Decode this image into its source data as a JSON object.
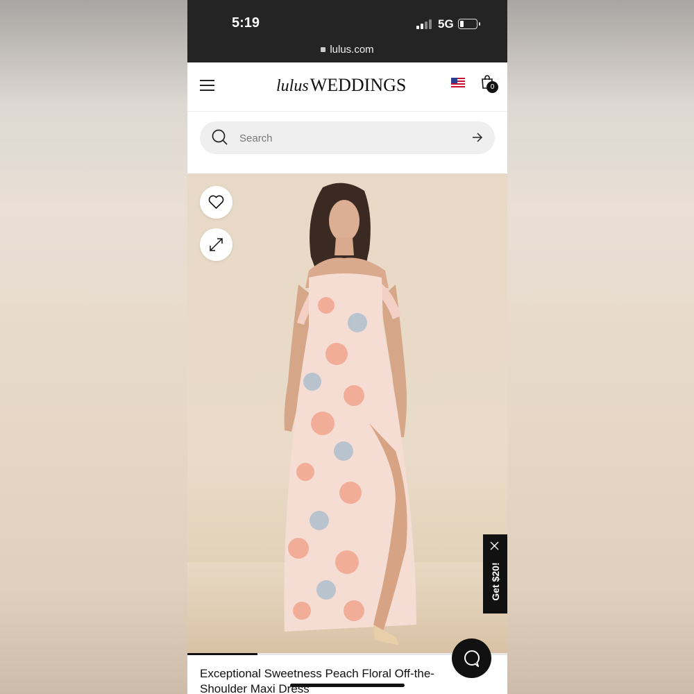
{
  "status": {
    "time": "5:19",
    "network": "5G",
    "url": "lulus.com"
  },
  "header": {
    "logo_script": "lulus",
    "logo_brand": "WEDDINGS",
    "cart_count": "0",
    "icons": [
      "hamburger-menu-icon",
      "us-flag-icon",
      "shopping-bag-icon"
    ]
  },
  "search": {
    "placeholder": "Search",
    "icons": [
      "search-icon",
      "arrow-right-icon"
    ]
  },
  "product": {
    "gallery_icons": [
      "heart-icon",
      "expand-icon"
    ],
    "gallery_progress": 0.22,
    "title": "Exceptional Sweetness Peach Floral Off-the-Shoulder Maxi Dress"
  },
  "promo": {
    "label": "Get $20!"
  },
  "colors": {
    "status_bar": "#242424",
    "accent_dark": "#111111",
    "search_bg": "#efefef",
    "photo_bg": "#e7d9c6",
    "dress_peach": "#f2a58e",
    "dress_blue": "#aebfcd"
  }
}
